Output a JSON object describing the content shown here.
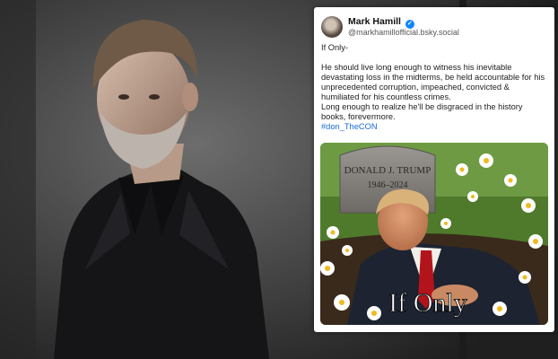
{
  "post": {
    "author_name": "Mark Hamill",
    "verified_glyph": "✓",
    "author_handle": "@markhamillofficial.bsky.social",
    "text": {
      "line_intro": "If Only-",
      "line_1": "He should live long enough to witness his inevitable",
      "line_2": "devastating loss in the midterms, be held accountable for his",
      "line_3": "unprecedented corruption, impeached, convicted &",
      "line_4": "humiliated for his countless crimes.",
      "line_5": "Long enough to realize he'll be disgraced in the history",
      "line_6": "books, forevermore.",
      "hashtag": "#don_TheCON"
    },
    "image": {
      "headstone_name": "DONALD J. TRUMP",
      "headstone_years": "1946–2024",
      "caption": "If Only"
    }
  },
  "colors": {
    "hashtag": "#1a6bd6",
    "verified": "#1185fe",
    "tie": "#b3141b",
    "grass": "#4f7a2c"
  }
}
